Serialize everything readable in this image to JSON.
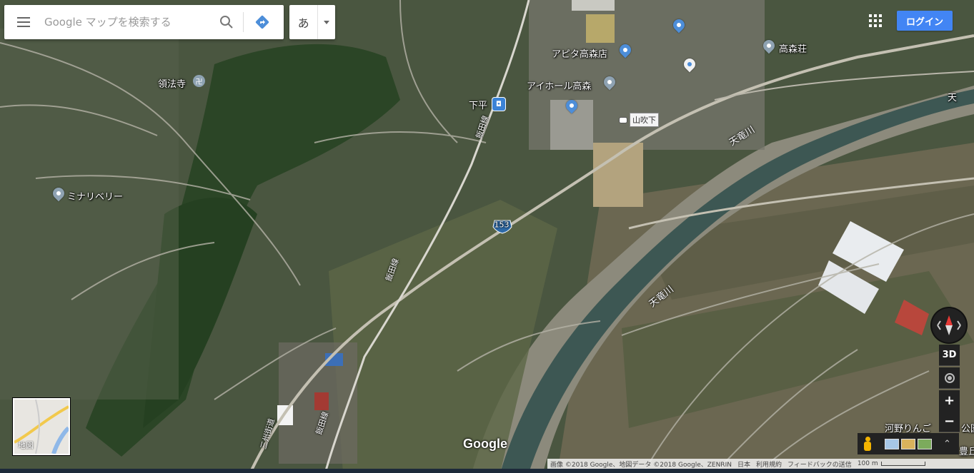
{
  "search": {
    "placeholder": "Google マップを検索する",
    "ime_char": "あ"
  },
  "header": {
    "login_label": "ログイン"
  },
  "places": [
    {
      "name": "領法寺",
      "icon": "temple-icon"
    },
    {
      "name": "ミナリベリー",
      "icon": "place-pin-icon"
    },
    {
      "name": "アピタ高森店",
      "icon": "shopping-pin-icon"
    },
    {
      "name": "アイホール高森",
      "icon": "place-pin-icon"
    },
    {
      "name": "高森荘",
      "icon": "place-pin-icon"
    },
    {
      "name": "下平",
      "icon": "train-station-icon"
    },
    {
      "name": "山吹下",
      "icon": "bus-stop-icon"
    },
    {
      "name": "河野りんご",
      "icon": ""
    },
    {
      "name": "公園",
      "icon": ""
    },
    {
      "name": "豊丘",
      "icon": ""
    },
    {
      "name": "天",
      "icon": ""
    }
  ],
  "rivers": [
    "天竜川",
    "天竜川"
  ],
  "rail_labels": [
    "飯田線",
    "飯田線",
    "飯田線"
  ],
  "road_labels": {
    "route_153": "153",
    "sanshu_kaido": "三州街道"
  },
  "controls": {
    "three_d": "3D",
    "zoom_in": "+",
    "zoom_out": "−",
    "minimap_label": "地図",
    "google_logo": "Google"
  },
  "footer": {
    "imagery": "画像 ©2018 Google、地図データ ©2018 Google、ZENRIN",
    "region": "日本",
    "terms": "利用規約",
    "feedback": "フィードバックの送信",
    "scale": "100 m"
  },
  "colors": {
    "accent": "#4285f4",
    "pin_blue": "#4d8ed9",
    "river": "#3d5753",
    "control_bg": "#222222"
  }
}
